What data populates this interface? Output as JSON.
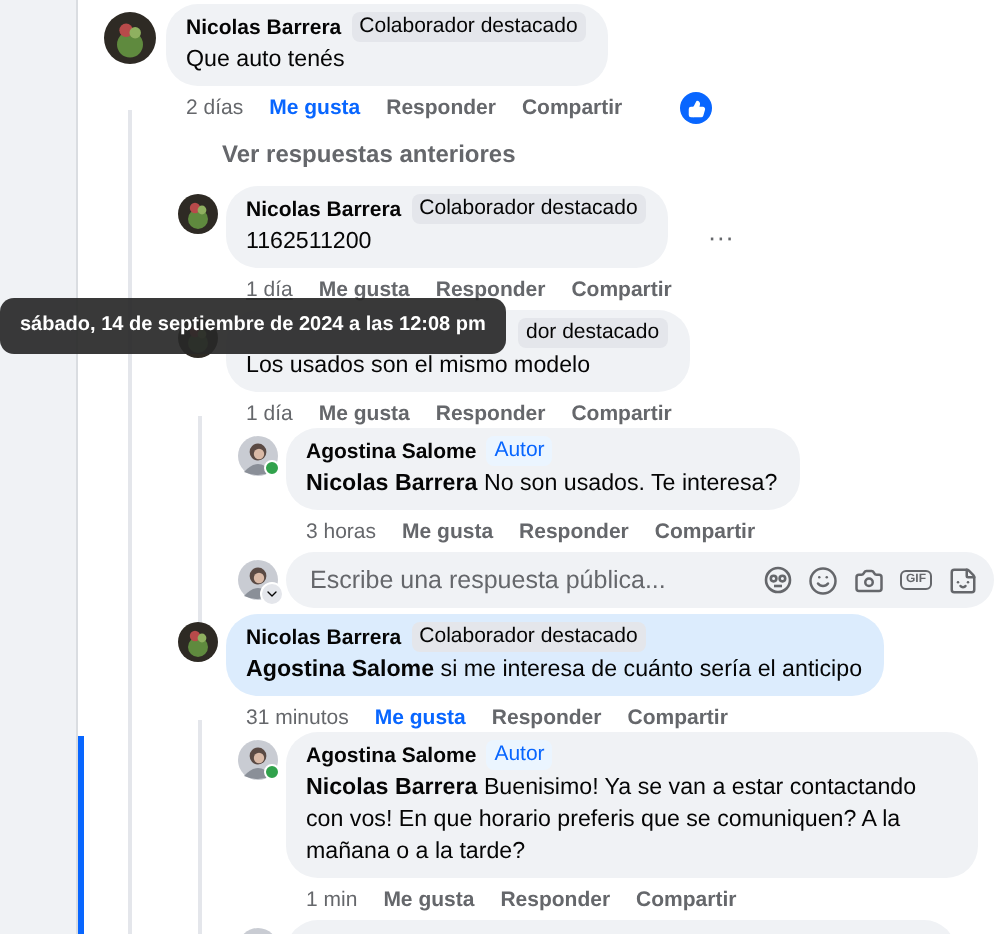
{
  "comments": [
    {
      "author": "Nicolas Barrera",
      "badge": {
        "text": "Colaborador destacado",
        "kind": "contributor"
      },
      "text": "Que auto tenés",
      "time": "2 días",
      "liked": true,
      "reaction": true,
      "like": "Me gusta",
      "reply": "Responder",
      "share": "Compartir",
      "previous_link": "Ver respuestas anteriores",
      "children": [
        {
          "author": "Nicolas Barrera",
          "badge": {
            "text": "Colaborador destacado",
            "kind": "contributor"
          },
          "text": "1162511200",
          "time": "1 día",
          "time_hovered": true,
          "menu": "···",
          "liked": false,
          "like": "Me gusta",
          "reply": "Responder",
          "share": "Compartir"
        },
        {
          "badge": {
            "text": "dor destacado",
            "kind": "contributor"
          },
          "text": "Los usados son el mismo modelo",
          "time": "1 día",
          "liked": false,
          "like": "Me gusta",
          "reply": "Responder",
          "share": "Compartir",
          "children": [
            {
              "author": "Agostina Salome",
              "badge": {
                "text": "Autor",
                "kind": "author"
              },
              "online": true,
              "text": "**Nicolas Barrera** No son usados. Te interesa?",
              "time": "3 horas",
              "liked": false,
              "like": "Me gusta",
              "reply": "Responder",
              "share": "Compartir"
            }
          ],
          "reply_box": {
            "placeholder": "Escribe una respuesta pública...",
            "gif": "GIF"
          }
        },
        {
          "author": "Nicolas Barrera",
          "badge": {
            "text": "Colaborador destacado",
            "kind": "contributor"
          },
          "highlighted": true,
          "text": "**Agostina Salome** si me interesa de cuánto sería el anticipo",
          "time": "31 minutos",
          "liked": true,
          "like": "Me gusta",
          "reply": "Responder",
          "share": "Compartir",
          "children": [
            {
              "author": "Agostina Salome",
              "badge": {
                "text": "Autor",
                "kind": "author"
              },
              "online": true,
              "text": "**Nicolas Barrera** Buenisimo! Ya se van a estar contactando con vos! En que horario preferis que se comuniquen? A la mañana o a la tarde?",
              "time": "1 min",
              "liked": false,
              "like": "Me gusta",
              "reply": "Responder",
              "share": "Compartir"
            },
            {
              "kind": "cut"
            }
          ]
        }
      ]
    }
  ],
  "tooltip": "sábado, 14 de septiembre de 2024 a las 12:08 pm"
}
